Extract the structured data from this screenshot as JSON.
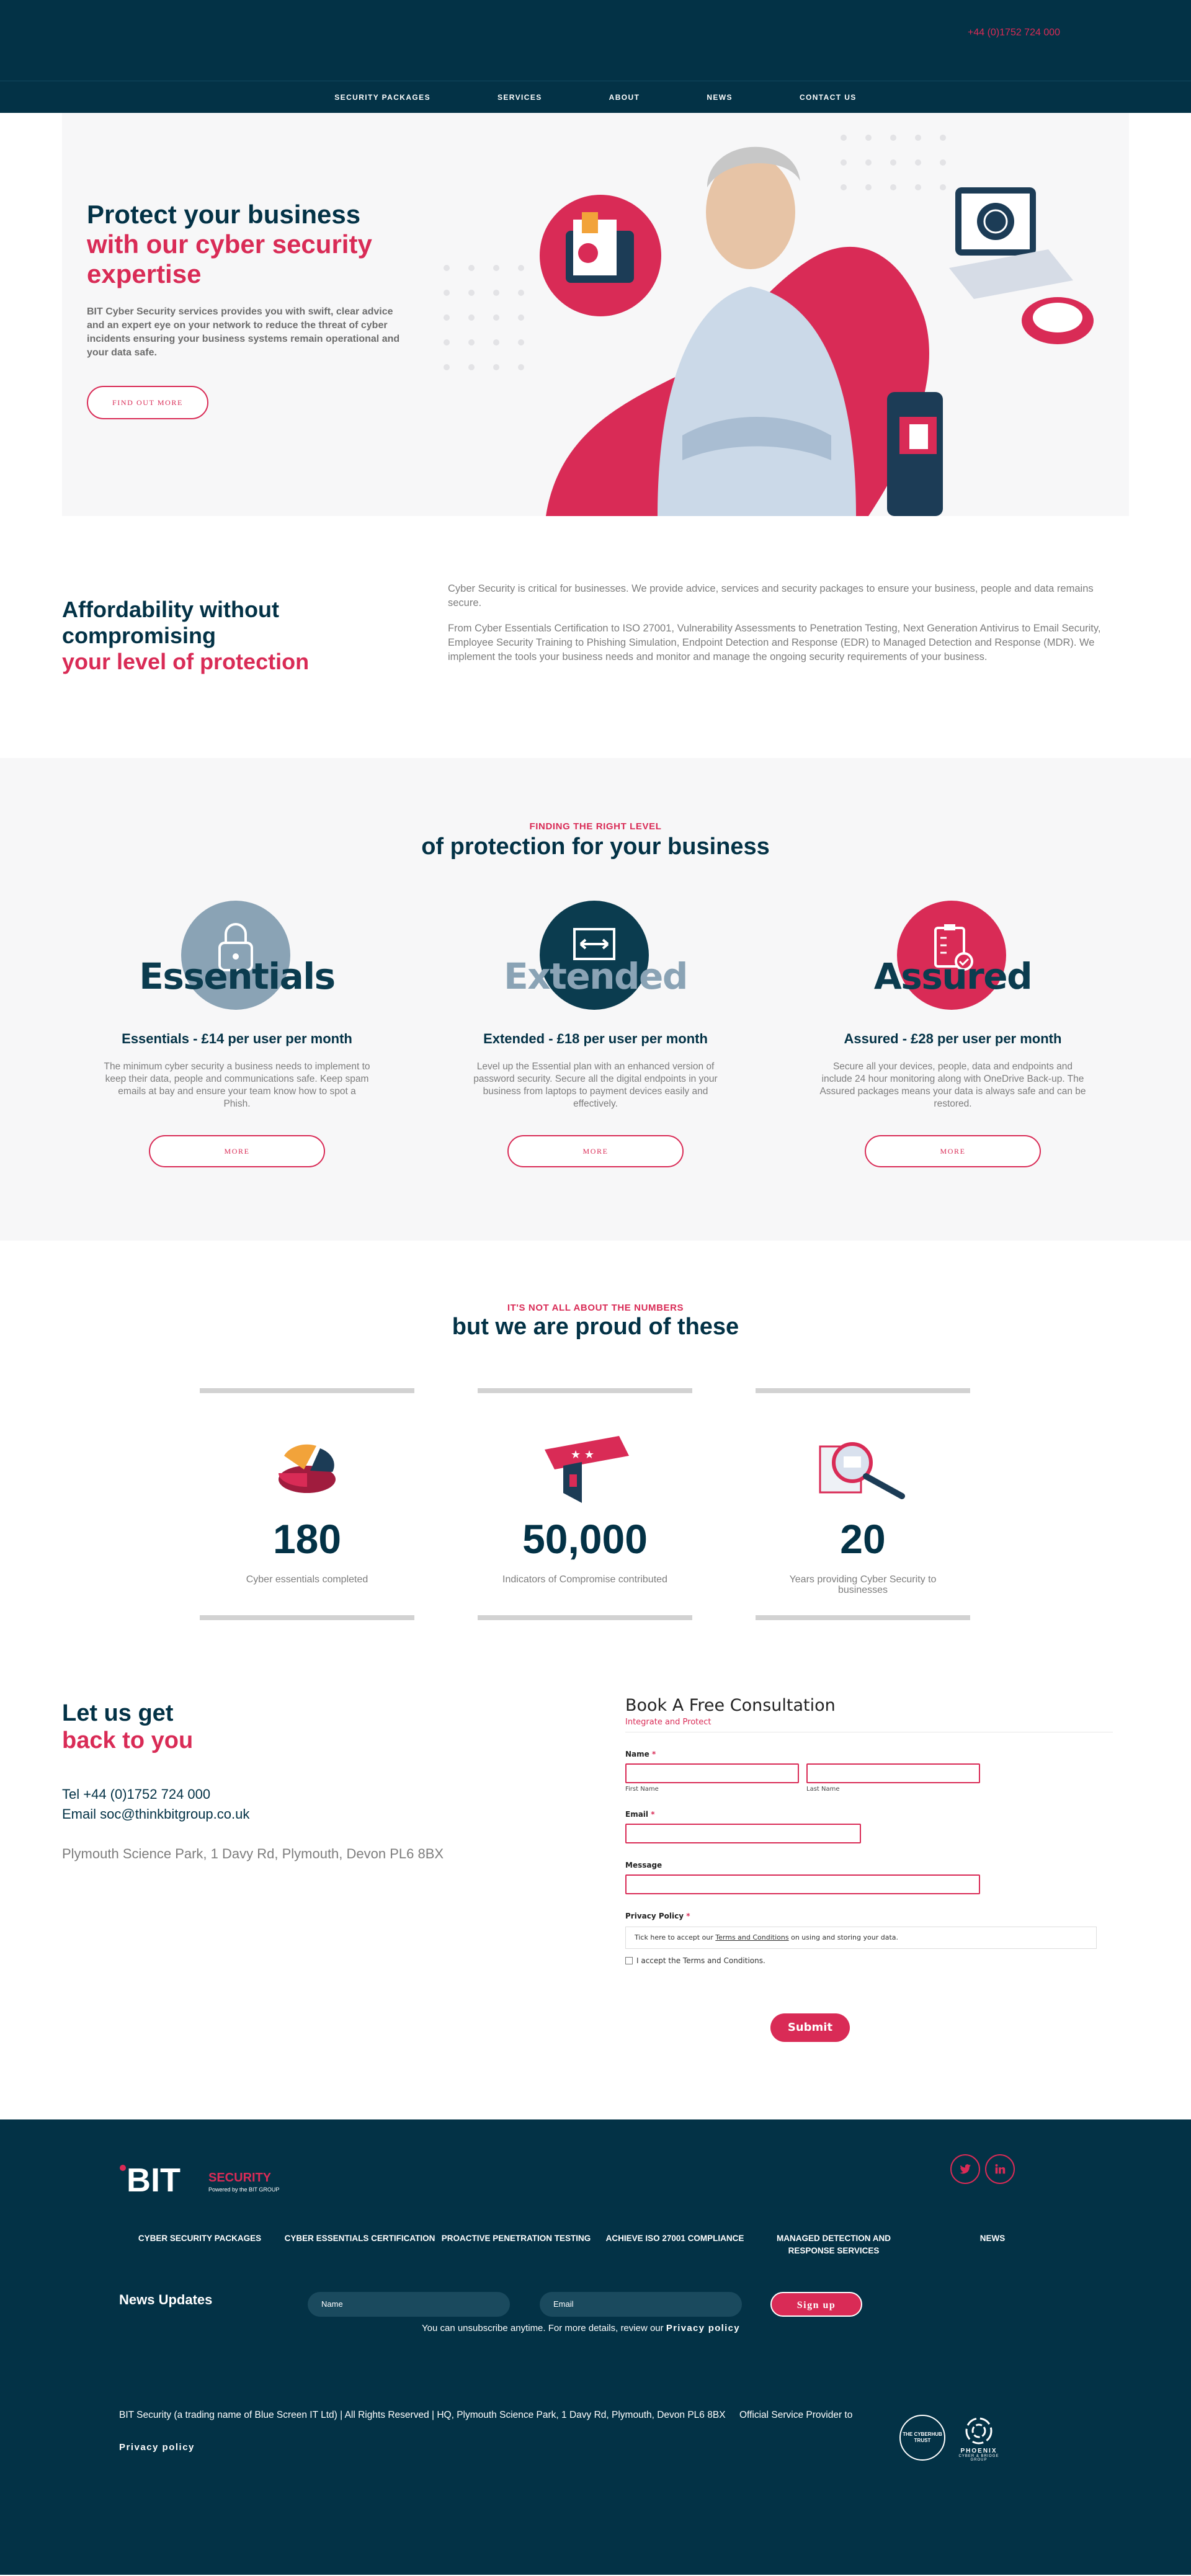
{
  "header": {
    "phone": "+44 (0)1752 724 000",
    "nav": [
      "SECURITY PACKAGES",
      "SERVICES",
      "ABOUT",
      "NEWS",
      "CONTACT US"
    ]
  },
  "hero": {
    "title_line1": "Protect your business",
    "title_line2": "with our cyber security expertise",
    "lead": "BIT Cyber Security services provides you with swift, clear advice and an expert eye on your network to reduce the threat of cyber incidents ensuring your business systems remain operational and your data safe.",
    "button": "FIND OUT MORE"
  },
  "affordability": {
    "title_line1": "Affordability without compromising",
    "title_line2": "your level of protection",
    "para1": "Cyber Security is critical for businesses. We provide advice, services and security packages to ensure your business, people and data remains secure.",
    "para2": "From Cyber Essentials Certification to ISO 27001, Vulnerability Assessments to Penetration Testing, Next Generation Antivirus to Email Security, Employee Security Training to Phishing Simulation, Endpoint Detection and Response (EDR) to Managed Detection and Response (MDR). We implement the tools your business needs and monitor and manage the ongoing security requirements of your business."
  },
  "packages": {
    "kicker": "FINDING THE RIGHT LEVEL",
    "title": "of protection for your business",
    "items": [
      {
        "badge": "Essentials",
        "title": "Essentials - £14 per user per month",
        "desc": "The minimum cyber security a business needs to implement to keep their data, people and communications safe. Keep spam emails at bay and ensure your team know how to spot a Phish.",
        "button": "MORE"
      },
      {
        "badge": "Extended",
        "title": "Extended - £18 per user per month",
        "desc": "Level up the Essential plan with an enhanced version of password security. Secure all the digital endpoints in your business from laptops to payment devices easily and effectively.",
        "button": "MORE"
      },
      {
        "badge": "Assured",
        "title": "Assured - £28 per user per month",
        "desc": "Secure all your devices, people, data and endpoints and include 24 hour monitoring along with OneDrive Back-up. The Assured packages means your data is always safe and can be restored.",
        "button": "MORE"
      }
    ]
  },
  "stats": {
    "kicker": "IT'S NOT ALL ABOUT THE NUMBERS",
    "title": "but we are proud of these",
    "items": [
      {
        "number": "180",
        "label": "Cyber essentials completed"
      },
      {
        "number": "50,000",
        "label": "Indicators of Compromise contributed"
      },
      {
        "number": "20",
        "label": "Years providing Cyber Security to businesses"
      }
    ]
  },
  "contact": {
    "title_line1": "Let us get",
    "title_line2": "back to you",
    "tel": "Tel +44 (0)1752 724 000",
    "email": "Email soc@thinkbitgroup.co.uk",
    "address": "Plymouth Science Park, 1 Davy Rd, Plymouth, Devon PL6 8BX",
    "form": {
      "title": "Book A Free Consultation",
      "subtitle": "Integrate and Protect",
      "name_label": "Name",
      "first_name": "First Name",
      "last_name": "Last Name",
      "email_label": "Email",
      "message_label": "Message",
      "privacy_label": "Privacy Policy",
      "privacy_text_pre": "Tick here to accept our",
      "privacy_link": "Terms and Conditions",
      "privacy_text_post": "on using and storing your data.",
      "accept": "I accept the Terms and Conditions.",
      "submit": "Submit",
      "required_mark": "*"
    }
  },
  "footer": {
    "logo_text": "BIT",
    "logo_sub": "SECURITY",
    "logo_tag": "Powered by the BIT GROUP",
    "nav": [
      "CYBER SECURITY PACKAGES",
      "CYBER ESSENTIALS CERTIFICATION",
      "PROACTIVE PENETRATION TESTING",
      "ACHIEVE ISO 27001 COMPLIANCE",
      "MANAGED DETECTION AND RESPONSE SERVICES",
      "NEWS"
    ],
    "news_title": "News Updates",
    "name_placeholder": "Name",
    "email_placeholder": "Email",
    "signup": "Sign up",
    "unsub_text": "You can unsubscribe anytime. For more details, review our",
    "unsub_link": "Privacy policy",
    "legal": "BIT Security (a trading name of Blue Screen IT Ltd) | All Rights Reserved | HQ, Plymouth Science Park, 1 Davy Rd, Plymouth, Devon PL6 8BX",
    "privacy": "Privacy policy",
    "official": "Official Service Provider to",
    "partner1": "THE CYBERHUB TRUST",
    "partner2": "PHOENIX",
    "partner2_sub": "CYBER & BRIDGE GROUP"
  },
  "colors": {
    "navy": "#033246",
    "red": "#d92b56",
    "grey": "#7d7d7d",
    "essentials": "#8aa3b5",
    "extended": "#0b3c4f",
    "assured": "#d92b56"
  },
  "icons": [
    "twitter-icon",
    "linkedin-icon",
    "padlock-icon",
    "arrows-icon",
    "checklist-icon",
    "pie-chart-icon",
    "stars-card-icon",
    "magnifier-icon"
  ]
}
